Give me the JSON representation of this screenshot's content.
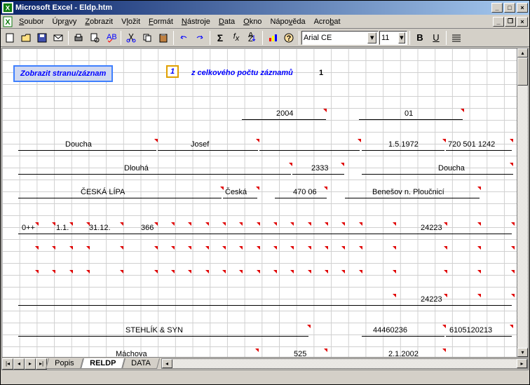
{
  "window": {
    "title": "Microsoft Excel - Eldp.htm"
  },
  "menu": {
    "items": [
      "Soubor",
      "Úpravy",
      "Zobrazit",
      "Vložit",
      "Formát",
      "Nástroje",
      "Data",
      "Okno",
      "Nápověda",
      "Acrobat"
    ]
  },
  "toolbar": {
    "font": "Arial CE",
    "size": "11",
    "bold": "B",
    "underline": "U"
  },
  "header": {
    "button": "Zobrazit stranu/záznam",
    "recno": "1",
    "total_label": "z celkového počtu záznamů",
    "total": "1"
  },
  "data": {
    "year": "2004",
    "seq": "01",
    "surname": "Doucha",
    "name": "Josef",
    "dob": "1.5.1972",
    "birthno": "720 501 1242",
    "street": "Dlouhá",
    "houseno": "2333",
    "family": "Doucha",
    "city": "ČESKÁ LÍPA",
    "country": "Česká",
    "zip": "470 06",
    "town2": "Benešov n. Ploučnicí",
    "code": "0++",
    "from": "1.1.",
    "to": "31.12.",
    "days": "366",
    "sum": "24223",
    "total": "24223",
    "company": "STEHLÍK & SYN",
    "ico": "44460236",
    "varsym": "6105120213",
    "street2": "Máchova",
    "cp": "525",
    "signed": "2.1.2002"
  },
  "tabs": {
    "t1": "Popis",
    "t2": "RELDP",
    "t3": "DATA"
  }
}
